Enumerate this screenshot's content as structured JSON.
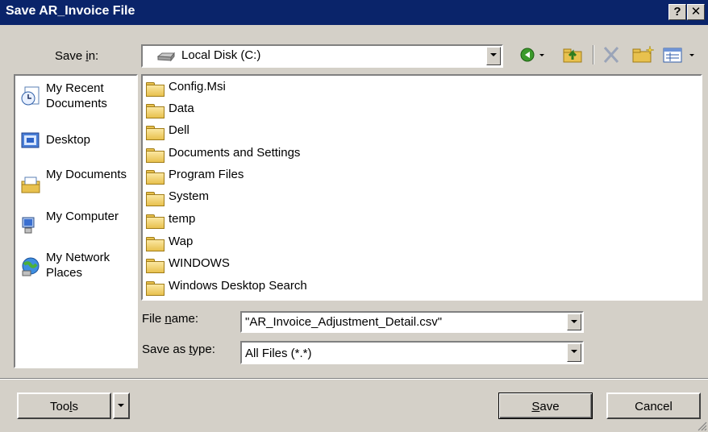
{
  "window": {
    "title": "Save AR_Invoice File",
    "help_label": "?",
    "close_label": "✕"
  },
  "save_in": {
    "label_pre": "Save ",
    "label_key": "i",
    "label_post": "n:",
    "value": "Local Disk (C:)"
  },
  "places": [
    {
      "label": "My Recent Documents",
      "icon": "recent-documents-icon"
    },
    {
      "label": "Desktop",
      "icon": "desktop-icon"
    },
    {
      "label": "My Documents",
      "icon": "my-documents-icon"
    },
    {
      "label": "My Computer",
      "icon": "my-computer-icon"
    },
    {
      "label": "My Network Places",
      "icon": "network-places-icon"
    }
  ],
  "files": [
    "Config.Msi",
    "Data",
    "Dell",
    "Documents and Settings",
    "Program Files",
    "System",
    "temp",
    "Wap",
    "WINDOWS",
    "Windows Desktop Search"
  ],
  "file_name": {
    "label_pre": "File ",
    "label_key": "n",
    "label_post": "ame:",
    "value": "\"AR_Invoice_Adjustment_Detail.csv\""
  },
  "save_as_type": {
    "label_pre": "Save as ",
    "label_key": "t",
    "label_post": "ype:",
    "value": "All Files (*.*)"
  },
  "buttons": {
    "tools_pre": "Too",
    "tools_key": "l",
    "tools_post": "s",
    "save_key": "S",
    "save_post": "ave",
    "cancel": "Cancel"
  },
  "toolbar_icons": [
    "back-icon",
    "up-folder-icon",
    "delete-icon",
    "new-folder-icon",
    "views-icon"
  ]
}
